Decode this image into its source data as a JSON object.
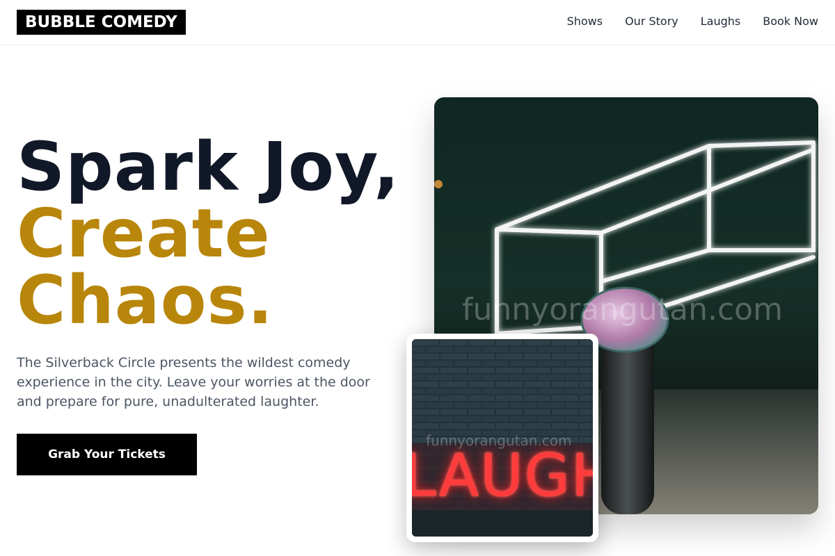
{
  "brand": {
    "logo": "BUBBLE COMEDY"
  },
  "nav": {
    "items": [
      "Shows",
      "Our Story",
      "Laughs",
      "Book Now"
    ]
  },
  "hero": {
    "line1": "Spark Joy,",
    "line2": "Create",
    "line3": "Chaos.",
    "subtitle": "The Silverback Circle presents the wildest comedy experience in the city. Leave your worries at the door and prepare for pure, unadulterated laughter.",
    "cta_label": "Grab Your Tickets"
  },
  "images": {
    "main_watermark": "funnyorangutan.com",
    "inset_watermark": "funnyorangutan.com",
    "inset_sign_text": "LAUGH"
  },
  "colors": {
    "accent": "#b8860b",
    "dark": "#111827",
    "body_text": "#4b5563"
  }
}
